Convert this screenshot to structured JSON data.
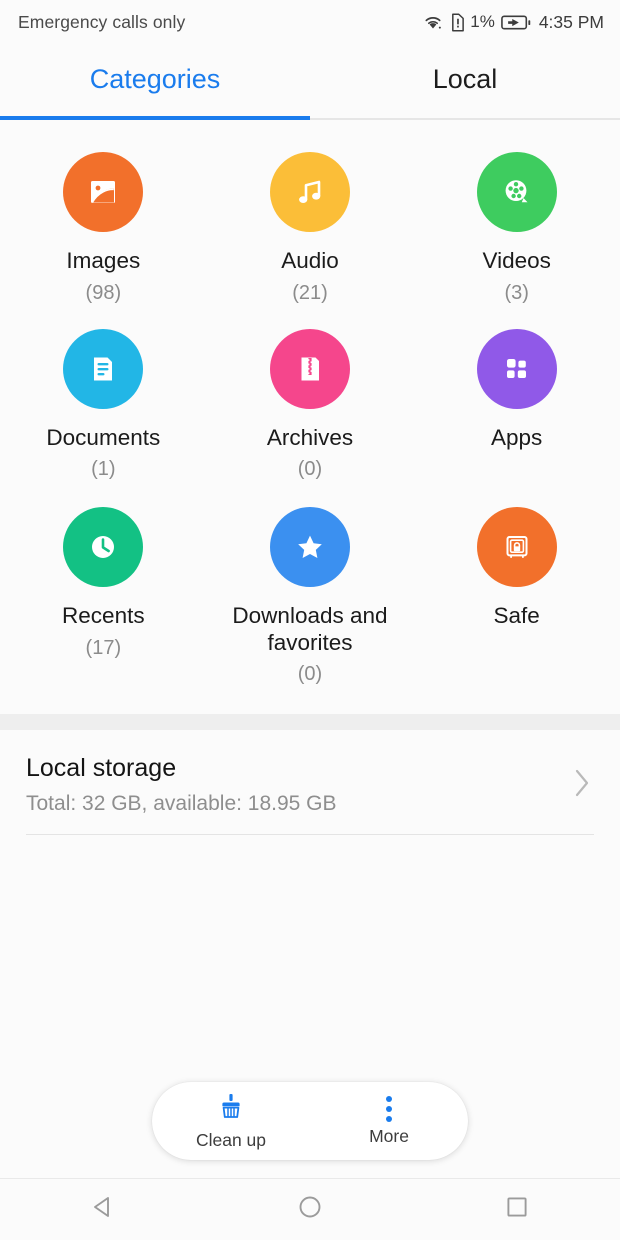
{
  "status_bar": {
    "carrier_text": "Emergency calls only",
    "wifi_icon": "wifi-icon",
    "sim_icon": "sim-card-alert-icon",
    "battery_percent": "1%",
    "battery_icon": "battery-charging-icon",
    "clock": "4:35 PM"
  },
  "tabs": [
    {
      "label": "Categories",
      "active": true
    },
    {
      "label": "Local",
      "active": false
    }
  ],
  "categories": [
    {
      "label": "Images",
      "count": "(98)",
      "icon": "image-icon",
      "color": "#F2702B"
    },
    {
      "label": "Audio",
      "count": "(21)",
      "icon": "music-note-icon",
      "color": "#FBBE38"
    },
    {
      "label": "Videos",
      "count": "(3)",
      "icon": "film-reel-icon",
      "color": "#3ECC5F"
    },
    {
      "label": "Documents",
      "count": "(1)",
      "icon": "document-icon",
      "color": "#22B6E6"
    },
    {
      "label": "Archives",
      "count": "(0)",
      "icon": "zip-file-icon",
      "color": "#F5468C"
    },
    {
      "label": "Apps",
      "count": "",
      "icon": "apps-grid-icon",
      "color": "#9059E8"
    },
    {
      "label": "Recents",
      "count": "(17)",
      "icon": "clock-icon",
      "color": "#13C184"
    },
    {
      "label": "Downloads and favorites",
      "count": "(0)",
      "icon": "star-icon",
      "color": "#3B90F0"
    },
    {
      "label": "Safe",
      "count": "",
      "icon": "safe-lock-icon",
      "color": "#F2702B"
    }
  ],
  "storage": {
    "title": "Local storage",
    "subtitle": "Total: 32 GB, available: 18.95 GB",
    "chevron_icon": "chevron-right-icon"
  },
  "bottom_bar": {
    "clean_up": {
      "label": "Clean up",
      "icon": "broom-icon"
    },
    "more": {
      "label": "More",
      "icon": "overflow-dots-icon"
    }
  },
  "nav_bar": {
    "back": "back-triangle-icon",
    "home": "home-circle-icon",
    "recents": "recents-square-icon"
  },
  "colors": {
    "accent": "#1a7ced",
    "background": "#fbfbfb",
    "band": "#eeeeee",
    "text_primary": "#1b1b1b",
    "text_secondary": "#8b8b8b"
  }
}
